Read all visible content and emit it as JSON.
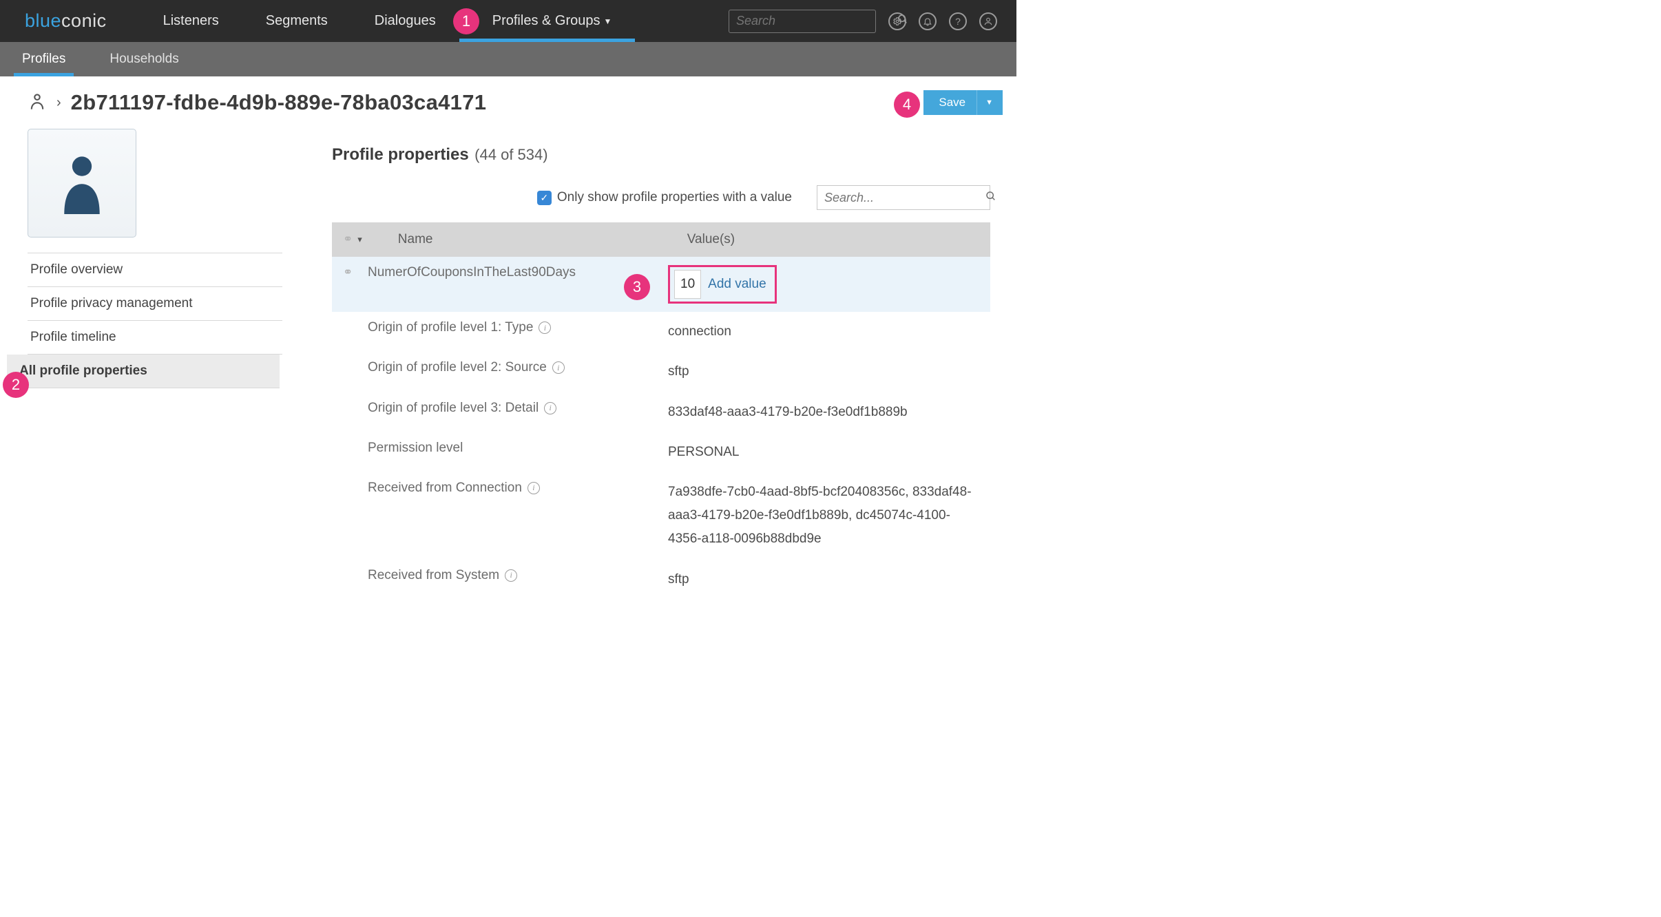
{
  "brand": {
    "part1": "blue",
    "part2": "conic"
  },
  "nav": {
    "items": [
      "Listeners",
      "Segments",
      "Dialogues",
      "Profiles & Groups"
    ],
    "activeIndex": 3
  },
  "topSearch": {
    "placeholder": "Search"
  },
  "subnav": {
    "items": [
      "Profiles",
      "Households"
    ],
    "activeIndex": 0
  },
  "header": {
    "title": "2b711197-fdbe-4d9b-889e-78ba03ca4171",
    "saveLabel": "Save"
  },
  "sidebar": {
    "items": [
      "Profile overview",
      "Profile privacy management",
      "Profile timeline",
      "All profile properties"
    ],
    "activeIndex": 3
  },
  "content": {
    "heading": "Profile properties",
    "count": "(44 of 534)",
    "onlyWithValue": "Only show profile properties with a value",
    "searchPlaceholder": "Search..."
  },
  "table": {
    "cols": {
      "name": "Name",
      "value": "Value(s)"
    },
    "addValue": "Add value",
    "rows": [
      {
        "name": "NumerOfCouponsInTheLast90Days",
        "value": "10",
        "editable": true
      },
      {
        "name": "Origin of profile level 1: Type",
        "value": "connection",
        "info": true
      },
      {
        "name": "Origin of profile level 2: Source",
        "value": "sftp",
        "info": true
      },
      {
        "name": "Origin of profile level 3: Detail",
        "value": "833daf48-aaa3-4179-b20e-f3e0df1b889b",
        "info": true
      },
      {
        "name": "Permission level",
        "value": "PERSONAL"
      },
      {
        "name": "Received from Connection",
        "value": "7a938dfe-7cb0-4aad-8bf5-bcf20408356c,  833daf48-aaa3-4179-b20e-f3e0df1b889b,  dc45074c-4100-4356-a118-0096b88dbd9e",
        "info": true
      },
      {
        "name": "Received from System",
        "value": "sftp",
        "info": true
      }
    ]
  },
  "badges": {
    "b1": "1",
    "b2": "2",
    "b3": "3",
    "b4": "4"
  }
}
